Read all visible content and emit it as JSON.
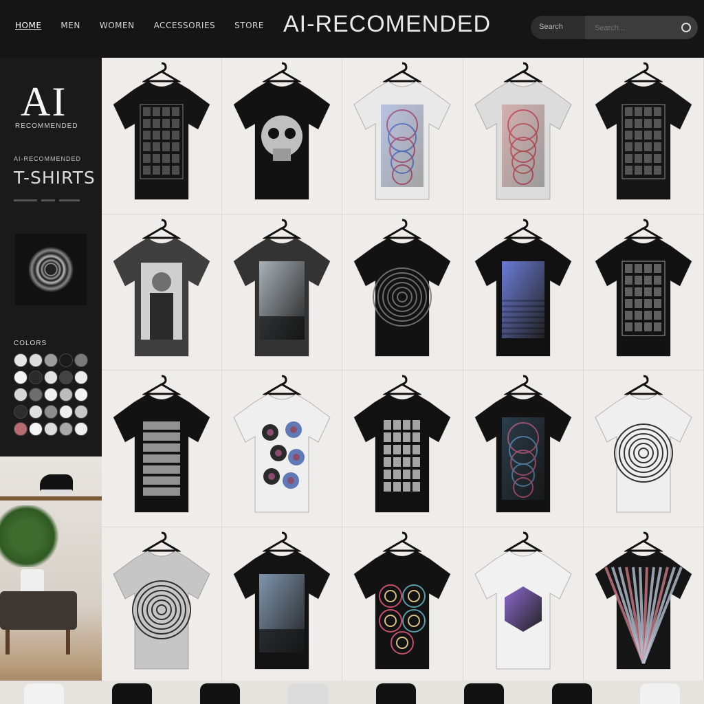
{
  "nav": {
    "items": [
      "HOME",
      "MEN",
      "WOMEN",
      "ACCESSORIES",
      "STORE"
    ]
  },
  "brand": "AI-RECOMENDED",
  "search": {
    "left_text": "Search",
    "placeholder": "Search..."
  },
  "sidebar": {
    "logo": "AI",
    "logo_sub": "RECOMMENDED",
    "promo_small": "AI-RECOMMENDED",
    "title": "T-SHIRTS",
    "colors_title": "COLORS",
    "swatches": [
      "#e6e6e6",
      "#dcdcdc",
      "#9d9d9d",
      "#1b1b1b",
      "#7a7a7a",
      "#f5f5f5",
      "#2a2a2a",
      "#e3e3e3",
      "#444444",
      "#ededed",
      "#d6d6d6",
      "#6d6d6d",
      "#efefef",
      "#bcbcbc",
      "#f3f3f3",
      "#2d2d2d",
      "#e0e0e0",
      "#8d8d8d",
      "#eeeeee",
      "#c9c9c9",
      "#b86b70",
      "#f6f6f6",
      "#dcdcdc",
      "#a9a9a9",
      "#efefef"
    ]
  },
  "products": [
    {
      "color": "#141414",
      "art": "#7c7c7c",
      "pattern": "grid"
    },
    {
      "color": "#121212",
      "art": "#cfcfcf",
      "pattern": "skull"
    },
    {
      "color": "#e9e9e9",
      "art": "#5e7bd6",
      "pattern": "swirl"
    },
    {
      "color": "#dcdcdc",
      "art": "#c85b5b",
      "pattern": "swirl"
    },
    {
      "color": "#151515",
      "art": "#8a8a8a",
      "pattern": "grid"
    },
    {
      "color": "#3f3f3f",
      "art": "#d8d8d8",
      "pattern": "portrait"
    },
    {
      "color": "#333333",
      "art": "#a9b1b8",
      "pattern": "scene"
    },
    {
      "color": "#121212",
      "art": "#777777",
      "pattern": "ornate"
    },
    {
      "color": "#111111",
      "art": "#6b7bd6",
      "pattern": "gradient"
    },
    {
      "color": "#121212",
      "art": "#a1a1a1",
      "pattern": "grid"
    },
    {
      "color": "#121212",
      "art": "#bdbdbd",
      "pattern": "stack"
    },
    {
      "color": "#efefef",
      "art": "#2c2c2c",
      "pattern": "flowers"
    },
    {
      "color": "#111111",
      "art": "#d6d6d6",
      "pattern": "tiles"
    },
    {
      "color": "#121212",
      "art": "#5b8db7",
      "pattern": "swirl"
    },
    {
      "color": "#efefef",
      "art": "#1d1d1d",
      "pattern": "ornate"
    },
    {
      "color": "#c6c6c6",
      "art": "#1c1c1c",
      "pattern": "ornate"
    },
    {
      "color": "#131313",
      "art": "#7f95ad",
      "pattern": "scene"
    },
    {
      "color": "#121212",
      "art": "#5c9ca9",
      "pattern": "circles"
    },
    {
      "color": "#f1f1f1",
      "art": "#8f6ad1",
      "pattern": "hex"
    },
    {
      "color": "#151515",
      "art": "#b8c1d1",
      "pattern": "rays"
    }
  ]
}
